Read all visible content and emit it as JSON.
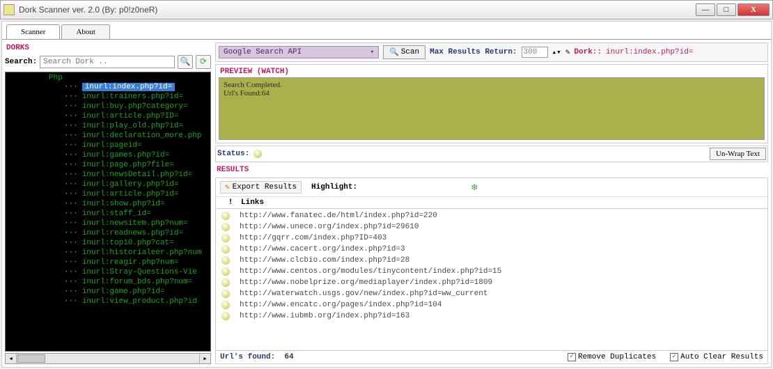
{
  "window": {
    "title": "Dork Scanner ver. 2.0 (By: p0!z0neR)"
  },
  "tabs": {
    "scanner": "Scanner",
    "about": "About"
  },
  "dorks": {
    "header": "DORKS",
    "search_label": "Search:",
    "search_placeholder": "Search Dork ..",
    "root": "Php",
    "items": [
      "inurl:index.php?id=",
      "inurl:trainers.php?id=",
      "inurl:buy.php?category=",
      "inurl:article.php?ID=",
      "inurl:play_old.php?id=",
      "inurl:declaration_more.php",
      "inurl:pageid=",
      "inurl:games.php?id=",
      "inurl:page.php?file=",
      "inurl:newsDetail.php?id=",
      "inurl:gallery.php?id=",
      "inurl:article.php?id=",
      "inurl:show.php?id=",
      "inurl:staff_id=",
      "inurl:newsitem.php?num=",
      "inurl:readnews.php?id=",
      "inurl:top10.php?cat=",
      "inurl:historialeer.php?num",
      "inurl:reagir.php?num=",
      "inurl:Stray-Questions-Vie",
      "inurl:forum_bds.php?num=",
      "inurl:game.php?id=",
      "inurl:view_product.php?id"
    ]
  },
  "topbar": {
    "dropdown": "Google Search API",
    "scan": "Scan",
    "max_label": "Max Results Return:",
    "max_value": "300",
    "dork_label": "Dork::",
    "dork_value": "inurl:index.php?id="
  },
  "preview": {
    "header": "PREVIEW (WATCH)",
    "line1": "Search Completed.",
    "line2": "Url's Found:64"
  },
  "status": {
    "label": "Status:",
    "unwrap": "Un-Wrap Text"
  },
  "results": {
    "header": "RESULTS",
    "export": "Export Results",
    "highlight": "Highlight:",
    "col_bang": "!",
    "col_links": "Links",
    "rows": [
      "http://www.fanatec.de/html/index.php?id=220",
      "http://www.unece.org/index.php?id=29610",
      "http://gqrr.com/index.php?ID=403",
      "http://www.cacert.org/index.php?id=3",
      "http://www.clcbio.com/index.php?id=28",
      "http://www.centos.org/modules/tinycontent/index.php?id=15",
      "http://www.nobelprize.org/mediaplayer/index.php?id=1809",
      "http://waterwatch.usgs.gov/new/index.php?id=ww_current",
      "http://www.encatc.org/pages/index.php?id=104",
      "http://www.iubmb.org/index.php?id=163"
    ]
  },
  "footer": {
    "found_label": "Url's found:",
    "found_value": "64",
    "remove_dup": "Remove Duplicates",
    "auto_clear": "Auto Clear Results"
  }
}
